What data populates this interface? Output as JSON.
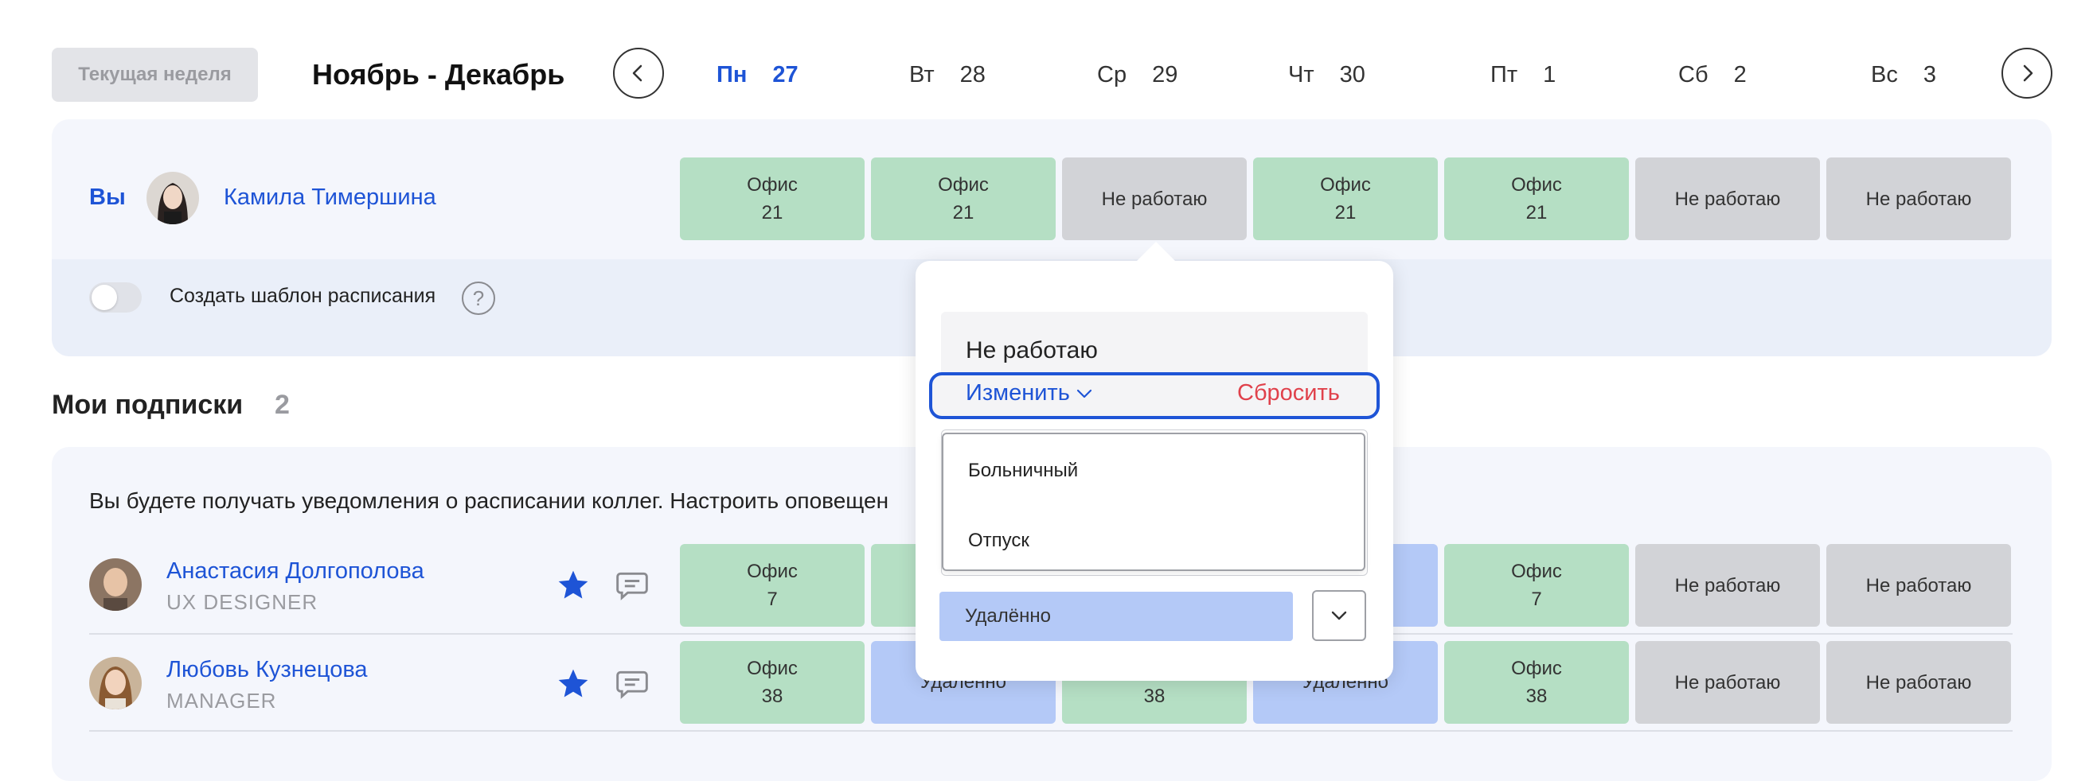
{
  "header": {
    "current_week_label": "Текущая неделя",
    "period_title": "Ноябрь - Декабрь",
    "days": [
      {
        "dow": "Пн",
        "date": "27"
      },
      {
        "dow": "Вт",
        "date": "28"
      },
      {
        "dow": "Ср",
        "date": "29"
      },
      {
        "dow": "Чт",
        "date": "30"
      },
      {
        "dow": "Пт",
        "date": "1"
      },
      {
        "dow": "Сб",
        "date": "2"
      },
      {
        "dow": "Вс",
        "date": "3"
      }
    ],
    "prev_icon": "chevron-left-icon",
    "next_icon": "chevron-right-icon"
  },
  "me": {
    "you_label": "Вы",
    "name": "Камила Тимершина",
    "schedule": [
      {
        "status": "Офис",
        "room": "21"
      },
      {
        "status": "Офис",
        "room": "21"
      },
      {
        "status": "Не работаю",
        "room": ""
      },
      {
        "status": "Офис",
        "room": "21"
      },
      {
        "status": "Офис",
        "room": "21"
      },
      {
        "status": "Не работаю",
        "room": ""
      },
      {
        "status": "Не работаю",
        "room": ""
      }
    ],
    "template_label": "Создать шаблон расписания",
    "help_glyph": "?"
  },
  "subscriptions": {
    "title": "Мои подписки",
    "count": "2",
    "notice": "Вы будете получать уведомления о расписании коллег. Настроить оповещен",
    "people": [
      {
        "name": "Анастасия Долгополова",
        "role": "UX DESIGNER",
        "schedule": [
          {
            "status": "Офис",
            "room": "7"
          },
          {
            "status": "",
            "room": ""
          },
          {
            "status": "",
            "room": ""
          },
          {
            "status": "",
            "room": ""
          },
          {
            "status": "Офис",
            "room": "7"
          },
          {
            "status": "Не работаю",
            "room": ""
          },
          {
            "status": "Не работаю",
            "room": ""
          }
        ]
      },
      {
        "name": "Любовь Кузнецова",
        "role": "MANAGER",
        "schedule": [
          {
            "status": "Офис",
            "room": "38"
          },
          {
            "status": "Удаленно",
            "room": ""
          },
          {
            "status": "",
            "room": "38"
          },
          {
            "status": "Удаленно",
            "room": ""
          },
          {
            "status": "Офис",
            "room": "38"
          },
          {
            "status": "Не работаю",
            "room": ""
          },
          {
            "status": "Не работаю",
            "room": ""
          }
        ]
      }
    ]
  },
  "popup": {
    "current_status": "Не работаю",
    "change_label": "Изменить",
    "reset_label": "Сбросить",
    "options": [
      "Больничный",
      "Отпуск"
    ],
    "selected": "Удалённо"
  },
  "colors": {
    "accent": "#1e54d6",
    "danger": "#e0414b",
    "office": "#b5dfc4",
    "off": "#d2d3d7",
    "remote": "#b4c9f7"
  }
}
